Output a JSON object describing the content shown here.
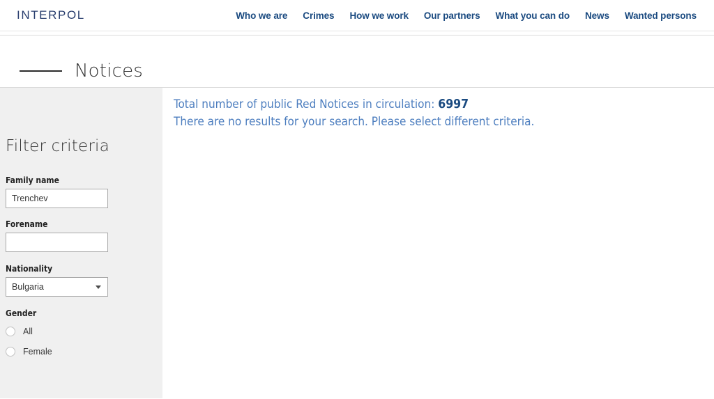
{
  "header": {
    "brand": "INTERPOL",
    "nav_items": [
      {
        "label": "Who we are"
      },
      {
        "label": "Crimes"
      },
      {
        "label": "How we work"
      },
      {
        "label": "Our partners"
      },
      {
        "label": "What you can do"
      },
      {
        "label": "News"
      },
      {
        "label": "Wanted persons"
      }
    ]
  },
  "page": {
    "title": "Notices"
  },
  "sidebar": {
    "heading": "Filter criteria",
    "fields": {
      "family_name": {
        "label": "Family name",
        "value": "Trenchev",
        "placeholder": ""
      },
      "forename": {
        "label": "Forename",
        "value": "",
        "placeholder": ""
      },
      "nationality": {
        "label": "Nationality",
        "selected": "Bulgaria",
        "arrow_icon": "chevron-down-icon"
      },
      "gender": {
        "label": "Gender",
        "options": [
          {
            "label": "All",
            "selected": false
          },
          {
            "label": "Female",
            "selected": false
          }
        ]
      }
    }
  },
  "results": {
    "total_prefix": "Total number of public Red Notices in circulation:",
    "total_count": "6997",
    "no_results_message": "There are no results for your search. Please select different criteria."
  },
  "colors": {
    "brand_navy": "#2a3f6f",
    "nav_blue": "#1a4a80",
    "results_blue": "#4d7ebf",
    "count_blue": "#1a4a80",
    "sidebar_bg": "#f0f0f0"
  }
}
